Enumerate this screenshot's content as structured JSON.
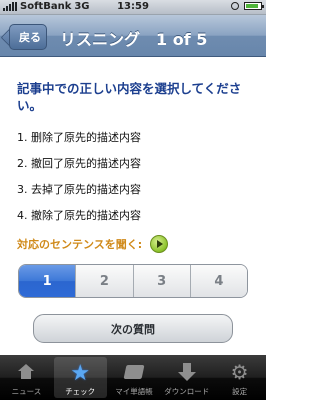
{
  "status_bar": {
    "carrier": "SoftBank",
    "network": "3G",
    "time": "13:59"
  },
  "nav": {
    "back_label": "戻る",
    "title": "リスニング　1 of 5"
  },
  "question": "記事中での正しい内容を選択してください。",
  "options": [
    "1. 删除了原先的描述内容",
    "2. 撤回了原先的描述内容",
    "3. 去掉了原先的描述内容",
    "4. 撤除了原先的描述内容"
  ],
  "listen": {
    "label": "対応のセンテンスを聞く:"
  },
  "segments": {
    "items": [
      "1",
      "2",
      "3",
      "4"
    ],
    "selected": "1"
  },
  "next_button_label": "次の質問",
  "tabbar": {
    "items": [
      {
        "label": "ニュース",
        "icon": "home-icon"
      },
      {
        "label": "チェック",
        "icon": "star-icon",
        "active": true
      },
      {
        "label": "マイ単語帳",
        "icon": "book-icon"
      },
      {
        "label": "ダウンロード",
        "icon": "download-icon"
      },
      {
        "label": "設定",
        "icon": "gear-icon"
      }
    ]
  },
  "colors": {
    "nav_gradient": "#7a96b9",
    "question_text": "#1c3f8f",
    "listen_label": "#d08a1a",
    "segment_selected": "#3d78d8",
    "play_button": "#8bc22a"
  }
}
